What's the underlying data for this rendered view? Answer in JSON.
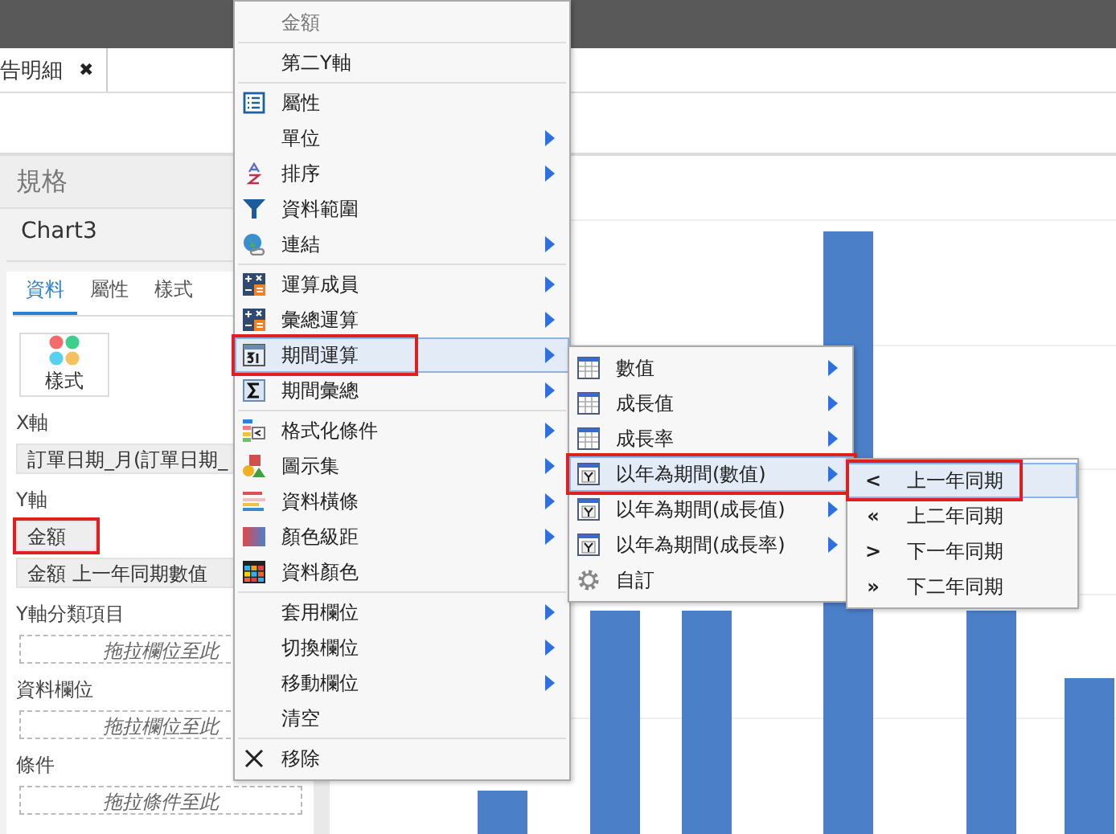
{
  "tab": {
    "label": "告明細",
    "close": "✖"
  },
  "spec_panel": {
    "title": "規格",
    "chart_name": "Chart3",
    "tabs": [
      {
        "label": "資料",
        "selected": true
      },
      {
        "label": "屬性",
        "selected": false
      },
      {
        "label": "樣式",
        "selected": false
      }
    ],
    "style_button": "樣式",
    "sections": [
      {
        "label": "X軸",
        "fields": [
          {
            "kind": "field",
            "text": "訂單日期_月(訂單日期_",
            "highlighted": false
          }
        ]
      },
      {
        "label": "Y軸",
        "fields": [
          {
            "kind": "field",
            "text": "金額",
            "highlighted": true
          },
          {
            "kind": "field",
            "text": "金額 上一年同期數值",
            "highlighted": false
          }
        ]
      },
      {
        "label": "Y軸分類項目",
        "fields": [
          {
            "kind": "drop",
            "text": "拖拉欄位至此"
          }
        ]
      },
      {
        "label": "資料欄位",
        "fields": [
          {
            "kind": "drop",
            "text": "拖拉欄位至此"
          }
        ]
      },
      {
        "label": "條件",
        "fields": [
          {
            "kind": "drop",
            "text": "拖拉條件至此"
          }
        ]
      }
    ]
  },
  "context_menu": {
    "items": [
      {
        "kind": "header",
        "label": "金額"
      },
      {
        "kind": "separator"
      },
      {
        "kind": "plain",
        "label": "第二Y軸",
        "submenu": false,
        "selected": false,
        "highlighted": false
      },
      {
        "kind": "separator"
      },
      {
        "kind": "list",
        "label": "屬性",
        "submenu": false,
        "selected": false,
        "highlighted": false
      },
      {
        "kind": "plain",
        "label": "單位",
        "submenu": true,
        "selected": false,
        "highlighted": false
      },
      {
        "kind": "sort",
        "label": "排序",
        "submenu": true,
        "selected": false,
        "highlighted": false
      },
      {
        "kind": "funnel",
        "label": "資料範圍",
        "submenu": false,
        "selected": false,
        "highlighted": false
      },
      {
        "kind": "globe",
        "label": "連結",
        "submenu": true,
        "selected": false,
        "highlighted": false
      },
      {
        "kind": "separator"
      },
      {
        "kind": "calc",
        "label": "運算成員",
        "submenu": true,
        "selected": false,
        "highlighted": false
      },
      {
        "kind": "calc",
        "label": "彙總運算",
        "submenu": true,
        "selected": false,
        "highlighted": false
      },
      {
        "kind": "calendar",
        "label": "期間運算",
        "submenu": true,
        "selected": true,
        "highlighted": true
      },
      {
        "kind": "sigma",
        "label": "期間彙總",
        "submenu": true,
        "selected": false,
        "highlighted": false
      },
      {
        "kind": "separator"
      },
      {
        "kind": "format",
        "label": "格式化條件",
        "submenu": true,
        "selected": false,
        "highlighted": false
      },
      {
        "kind": "shapes",
        "label": "圖示集",
        "submenu": true,
        "selected": false,
        "highlighted": false
      },
      {
        "kind": "databar",
        "label": "資料橫條",
        "submenu": true,
        "selected": false,
        "highlighted": false
      },
      {
        "kind": "gradient",
        "label": "顏色級距",
        "submenu": true,
        "selected": false,
        "highlighted": false
      },
      {
        "kind": "grid",
        "label": "資料顏色",
        "submenu": false,
        "selected": false,
        "highlighted": false
      },
      {
        "kind": "separator"
      },
      {
        "kind": "plain",
        "label": "套用欄位",
        "submenu": true,
        "selected": false,
        "highlighted": false
      },
      {
        "kind": "plain",
        "label": "切換欄位",
        "submenu": true,
        "selected": false,
        "highlighted": false
      },
      {
        "kind": "plain",
        "label": "移動欄位",
        "submenu": true,
        "selected": false,
        "highlighted": false
      },
      {
        "kind": "plain",
        "label": "清空",
        "submenu": false,
        "selected": false,
        "highlighted": false
      },
      {
        "kind": "separator"
      },
      {
        "kind": "remove",
        "label": "移除",
        "submenu": false,
        "selected": false,
        "highlighted": false
      }
    ]
  },
  "submenu": {
    "items": [
      {
        "kind": "table",
        "label": "數值",
        "submenu": true,
        "selected": false,
        "highlighted": false
      },
      {
        "kind": "table",
        "label": "成長值",
        "submenu": true,
        "selected": false,
        "highlighted": false
      },
      {
        "kind": "table",
        "label": "成長率",
        "submenu": true,
        "selected": false,
        "highlighted": false
      },
      {
        "kind": "year",
        "label": "以年為期間(數值)",
        "submenu": true,
        "selected": true,
        "highlighted": true
      },
      {
        "kind": "year",
        "label": "以年為期間(成長值)",
        "submenu": true,
        "selected": false,
        "highlighted": false
      },
      {
        "kind": "year",
        "label": "以年為期間(成長率)",
        "submenu": true,
        "selected": false,
        "highlighted": false
      },
      {
        "kind": "gear",
        "label": "自訂",
        "submenu": false,
        "selected": false,
        "highlighted": false
      }
    ]
  },
  "period_menu": {
    "items": [
      {
        "symbol": "<",
        "label": "上一年同期",
        "selected": true,
        "highlighted": true
      },
      {
        "symbol": "«",
        "label": "上二年同期",
        "selected": false,
        "highlighted": false
      },
      {
        "symbol": ">",
        "label": "下一年同期",
        "selected": false,
        "highlighted": false
      },
      {
        "symbol": "»",
        "label": "下二年同期",
        "selected": false,
        "highlighted": false
      }
    ]
  }
}
